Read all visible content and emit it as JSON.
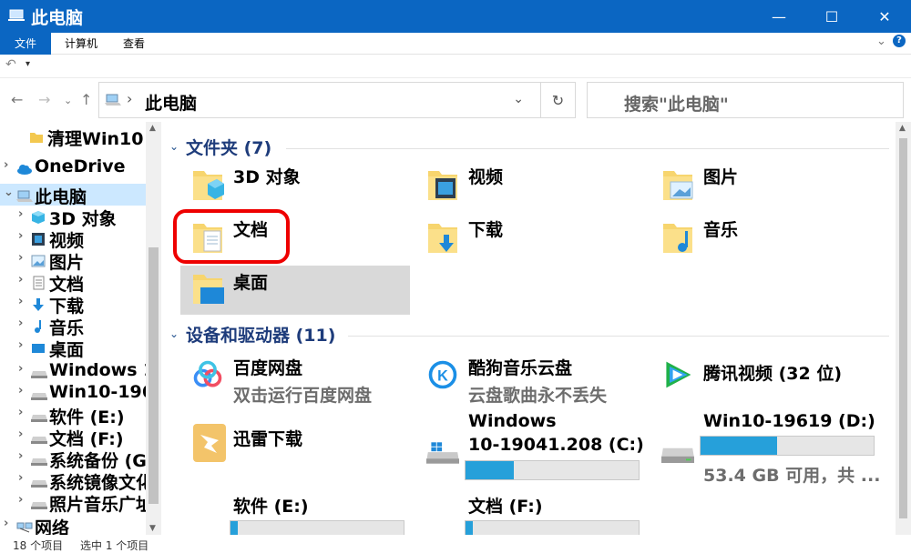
{
  "window": {
    "title": "此电脑",
    "minimize": "—",
    "maximize": "☐",
    "close": "✕"
  },
  "ribbon": {
    "tabs": [
      "文件",
      "计算机",
      "查看"
    ]
  },
  "address": {
    "path": "此电脑",
    "separator": "›",
    "dropdown": "⌄",
    "refresh": "↻",
    "search_placeholder": "搜索\"此电脑\""
  },
  "nav_buttons": {
    "back": "←",
    "forward": "→",
    "dropdown": "⌄",
    "up": "↑"
  },
  "nav": {
    "items": [
      {
        "label": "清理Win10",
        "icon": "folder-icon",
        "indent": 1
      },
      {
        "label": "OneDrive",
        "icon": "cloud-icon",
        "indent": 0
      },
      {
        "label": "此电脑",
        "icon": "computer-icon",
        "indent": 0
      },
      {
        "label": "3D 对象",
        "icon": "cube-icon",
        "indent": 1
      },
      {
        "label": "视频",
        "icon": "film-icon",
        "indent": 1
      },
      {
        "label": "图片",
        "icon": "picture-icon",
        "indent": 1
      },
      {
        "label": "文档",
        "icon": "document-icon",
        "indent": 1
      },
      {
        "label": "下载",
        "icon": "download-icon",
        "indent": 1
      },
      {
        "label": "音乐",
        "icon": "music-icon",
        "indent": 1
      },
      {
        "label": "桌面",
        "icon": "desktop-icon",
        "indent": 1
      },
      {
        "label": "Windows 1",
        "icon": "drive-icon",
        "indent": 1
      },
      {
        "label": "Win10-196",
        "icon": "drive-icon",
        "indent": 1
      },
      {
        "label": "软件 (E:)",
        "icon": "drive-icon",
        "indent": 1
      },
      {
        "label": "文档 (F:)",
        "icon": "drive-icon",
        "indent": 1
      },
      {
        "label": "系统备份 (G",
        "icon": "drive-icon",
        "indent": 1
      },
      {
        "label": "系统镜像文化",
        "icon": "drive-icon",
        "indent": 1
      },
      {
        "label": "照片音乐广址",
        "icon": "drive-icon",
        "indent": 1
      },
      {
        "label": "网络",
        "icon": "network-icon",
        "indent": 0
      }
    ]
  },
  "content": {
    "folders_header": "文件夹 (7)",
    "folders": [
      "3D 对象",
      "视频",
      "图片",
      "文档",
      "下载",
      "音乐",
      "桌面"
    ],
    "devices_header": "设备和驱动器 (11)",
    "devices": [
      {
        "name": "百度网盘",
        "sub": "双击运行百度网盘"
      },
      {
        "name": "酷狗音乐云盘",
        "sub": "云盘歌曲永不丢失"
      },
      {
        "name": "腾讯视频 (32 位)"
      },
      {
        "name": "迅雷下载"
      },
      {
        "name1": "Windows",
        "name2": "10-19041.208 (C:)",
        "fill": 0.28
      },
      {
        "name": "Win10-19619 (D:)",
        "sub": "53.4 GB 可用，共 ...",
        "fill": 0.44
      },
      {
        "name": "软件 (E:)",
        "fill": 0.04
      },
      {
        "name": "文档 (F:)",
        "fill": 0.04
      }
    ]
  },
  "status": {
    "count": "18 个项目",
    "selected": "选中 1 个项目"
  },
  "colors": {
    "accent": "#0b66c2",
    "drive_fill": "#26a0da",
    "selection": "#cce8ff",
    "highlight": "#e00000"
  }
}
